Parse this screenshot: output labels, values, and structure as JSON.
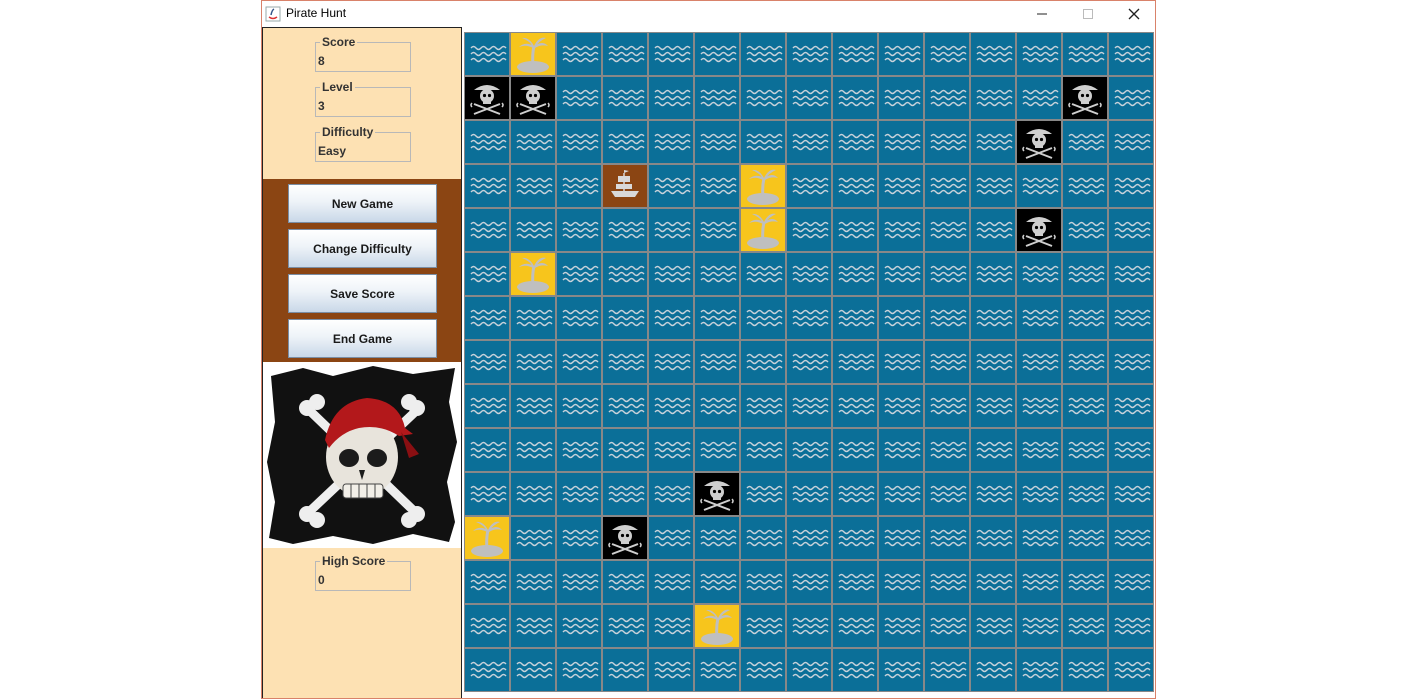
{
  "window": {
    "title": "Pirate Hunt"
  },
  "stats": {
    "score": {
      "label": "Score",
      "value": "8"
    },
    "level": {
      "label": "Level",
      "value": "3"
    },
    "difficulty": {
      "label": "Difficulty",
      "value": "Easy"
    },
    "high_score": {
      "label": "High Score",
      "value": "0"
    }
  },
  "buttons": {
    "new_game": "New Game",
    "change_difficulty": "Change Difficulty",
    "save_score": "Save Score",
    "end_game": "End Game"
  },
  "colors": {
    "panel_bg": "#fde1b3",
    "button_panel_bg": "#8b4513",
    "water": "#0b6f98",
    "island": "#f7c51c",
    "pirate": "#000000",
    "ship": "#8b4513"
  },
  "board": {
    "rows": 15,
    "cols": 15,
    "default_tile": "water",
    "special_tiles": [
      {
        "row": 0,
        "col": 1,
        "type": "island"
      },
      {
        "row": 1,
        "col": 0,
        "type": "pirate"
      },
      {
        "row": 1,
        "col": 1,
        "type": "pirate"
      },
      {
        "row": 1,
        "col": 13,
        "type": "pirate"
      },
      {
        "row": 2,
        "col": 12,
        "type": "pirate"
      },
      {
        "row": 3,
        "col": 3,
        "type": "ship"
      },
      {
        "row": 3,
        "col": 6,
        "type": "island"
      },
      {
        "row": 4,
        "col": 6,
        "type": "island"
      },
      {
        "row": 4,
        "col": 12,
        "type": "pirate"
      },
      {
        "row": 5,
        "col": 1,
        "type": "island"
      },
      {
        "row": 10,
        "col": 5,
        "type": "pirate"
      },
      {
        "row": 11,
        "col": 0,
        "type": "island"
      },
      {
        "row": 11,
        "col": 3,
        "type": "pirate"
      },
      {
        "row": 13,
        "col": 5,
        "type": "island"
      }
    ]
  }
}
